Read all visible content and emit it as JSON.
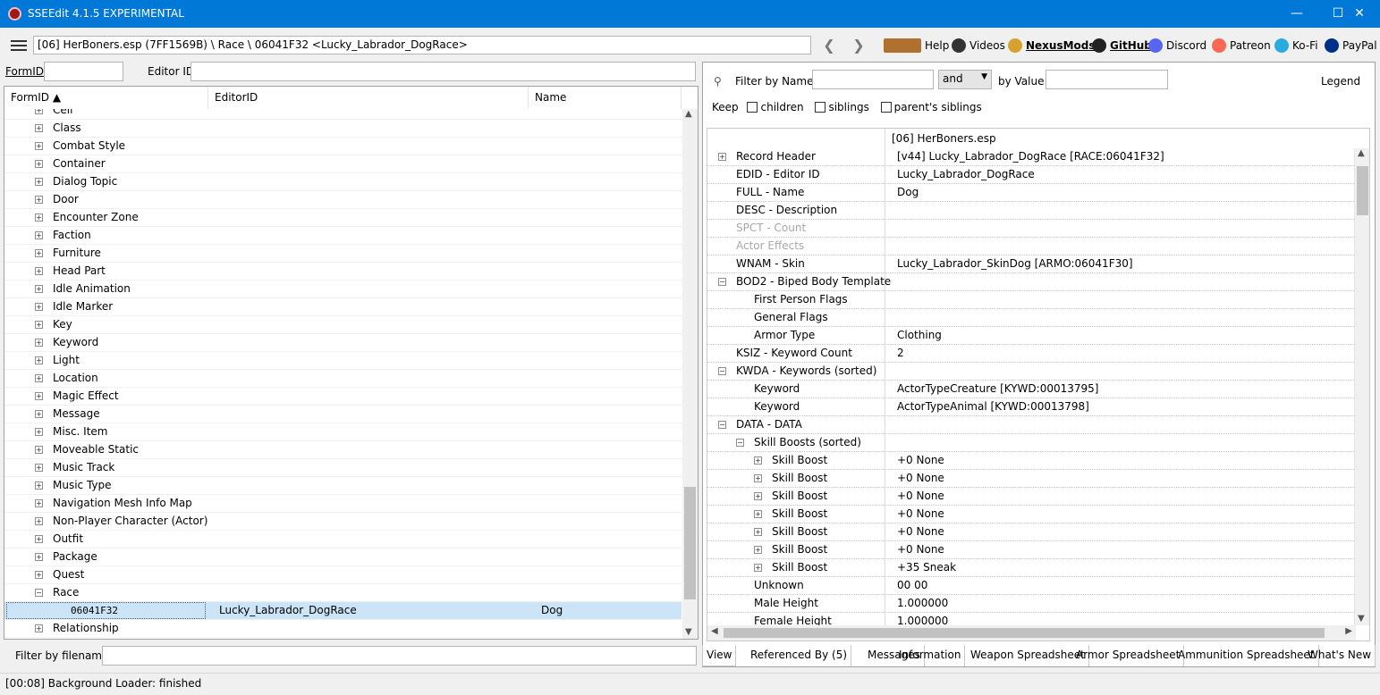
{
  "window": {
    "title": "SSEEdit 4.1.5 EXPERIMENTAL",
    "minimize": "—",
    "maximize": "☐",
    "close": "✕"
  },
  "nav": {
    "path": "[06] HerBoners.esp (7FF1569B) \\ Race \\ 06041F32 <Lucky_Labrador_DogRace>",
    "back": "❮",
    "forward": "❯",
    "links": [
      {
        "label": "Help",
        "icon": "book-icon"
      },
      {
        "label": "Videos",
        "icon": "video-icon"
      },
      {
        "label": "NexusMods",
        "icon": "nexus-icon"
      },
      {
        "label": "GitHub",
        "icon": "github-icon"
      },
      {
        "label": "Discord",
        "icon": "discord-icon"
      },
      {
        "label": "Patreon",
        "icon": "patreon-icon"
      },
      {
        "label": "Ko-Fi",
        "icon": "kofi-icon"
      },
      {
        "label": "PayPal",
        "icon": "paypal-icon"
      }
    ]
  },
  "left": {
    "formid_label": "FormID",
    "editorid_label": "Editor ID",
    "formid_value": "",
    "editorid_value": "",
    "columns": [
      "FormID ▲",
      "EditorID",
      "Name"
    ],
    "tree": [
      "Cell",
      "Class",
      "Combat Style",
      "Container",
      "Dialog Topic",
      "Door",
      "Encounter Zone",
      "Faction",
      "Furniture",
      "Head Part",
      "Idle Animation",
      "Idle Marker",
      "Key",
      "Keyword",
      "Light",
      "Location",
      "Magic Effect",
      "Message",
      "Misc. Item",
      "Moveable Static",
      "Music Track",
      "Music Type",
      "Navigation Mesh Info Map",
      "Non-Player Character (Actor)",
      "Outfit",
      "Package",
      "Quest",
      "Race"
    ],
    "selected": {
      "formid": "06041F32",
      "editorid": "Lucky_Labrador_DogRace",
      "name": "Dog"
    },
    "after": [
      "Relationship"
    ],
    "filter_label": "Filter by filename:",
    "filter_value": ""
  },
  "right": {
    "filter_name_label": "Filter by Name:",
    "filter_name_value": "",
    "op": "and",
    "filter_value_label": "by Value:",
    "filter_value_value": "",
    "legend": "Legend",
    "keep_label": "Keep",
    "keep_opts": [
      "children",
      "siblings",
      "parent's siblings"
    ],
    "file_header": "[06] HerBoners.esp",
    "rows": [
      {
        "label": "Record Header",
        "value": "[v44] Lucky_Labrador_DogRace [RACE:06041F32]",
        "indent": 0,
        "exp": "+"
      },
      {
        "label": "EDID - Editor ID",
        "value": "Lucky_Labrador_DogRace",
        "indent": 0,
        "exp": ""
      },
      {
        "label": "FULL - Name",
        "value": "Dog",
        "indent": 0,
        "exp": ""
      },
      {
        "label": "DESC - Description",
        "value": "",
        "indent": 0,
        "exp": ""
      },
      {
        "label": "SPCT - Count",
        "value": "",
        "indent": 0,
        "exp": "",
        "gray": true
      },
      {
        "label": "Actor Effects",
        "value": "",
        "indent": 0,
        "exp": "",
        "gray": true
      },
      {
        "label": "WNAM - Skin",
        "value": "Lucky_Labrador_SkinDog [ARMO:06041F30]",
        "indent": 0,
        "exp": ""
      },
      {
        "label": "BOD2 - Biped Body Template",
        "value": "",
        "indent": 0,
        "exp": "−"
      },
      {
        "label": "First Person Flags",
        "value": "",
        "indent": 1,
        "exp": ""
      },
      {
        "label": "General Flags",
        "value": "",
        "indent": 1,
        "exp": ""
      },
      {
        "label": "Armor Type",
        "value": "Clothing",
        "indent": 1,
        "exp": ""
      },
      {
        "label": "KSIZ - Keyword Count",
        "value": "2",
        "indent": 0,
        "exp": ""
      },
      {
        "label": "KWDA - Keywords (sorted)",
        "value": "",
        "indent": 0,
        "exp": "−"
      },
      {
        "label": "Keyword",
        "value": "ActorTypeCreature [KYWD:00013795]",
        "indent": 1,
        "exp": ""
      },
      {
        "label": "Keyword",
        "value": "ActorTypeAnimal [KYWD:00013798]",
        "indent": 1,
        "exp": ""
      },
      {
        "label": "DATA - DATA",
        "value": "",
        "indent": 0,
        "exp": "−"
      },
      {
        "label": "Skill Boosts (sorted)",
        "value": "",
        "indent": 1,
        "exp": "−"
      },
      {
        "label": "Skill Boost",
        "value": "+0 None",
        "indent": 2,
        "exp": "+"
      },
      {
        "label": "Skill Boost",
        "value": "+0 None",
        "indent": 2,
        "exp": "+"
      },
      {
        "label": "Skill Boost",
        "value": "+0 None",
        "indent": 2,
        "exp": "+"
      },
      {
        "label": "Skill Boost",
        "value": "+0 None",
        "indent": 2,
        "exp": "+"
      },
      {
        "label": "Skill Boost",
        "value": "+0 None",
        "indent": 2,
        "exp": "+"
      },
      {
        "label": "Skill Boost",
        "value": "+0 None",
        "indent": 2,
        "exp": "+"
      },
      {
        "label": "Skill Boost",
        "value": "+35 Sneak",
        "indent": 2,
        "exp": "+"
      },
      {
        "label": "Unknown",
        "value": "00 00",
        "indent": 1,
        "exp": ""
      },
      {
        "label": "Male Height",
        "value": "1.000000",
        "indent": 1,
        "exp": ""
      },
      {
        "label": "Female Height",
        "value": "1.000000",
        "indent": 1,
        "exp": ""
      }
    ],
    "tabs": [
      "View",
      "Referenced By (5)",
      "Messages",
      "Information",
      "Weapon Spreadsheet",
      "Armor Spreadsheet",
      "Ammunition Spreadsheet",
      "What's New"
    ]
  },
  "status": "[00:08] Background Loader: finished",
  "colors": {
    "titlebar": "#0078d7",
    "selection": "#cce4f7"
  }
}
